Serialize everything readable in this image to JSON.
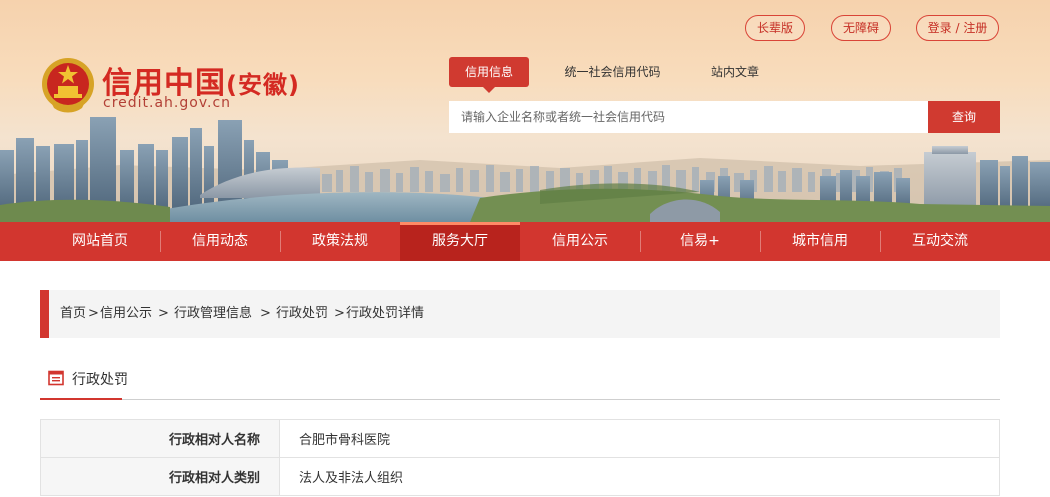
{
  "header": {
    "logo_title": "信用中国",
    "logo_region": "(安徽)",
    "logo_url": "credit.ah.gov.cn",
    "top_links": {
      "elder": "长辈版",
      "accessible": "无障碍",
      "login": "登录 / 注册"
    },
    "search_tabs": [
      "信用信息",
      "统一社会信用代码",
      "站内文章"
    ],
    "search": {
      "placeholder": "请输入企业名称或者统一社会信用代码",
      "button": "查询"
    }
  },
  "nav": {
    "items": [
      "网站首页",
      "信用动态",
      "政策法规",
      "服务大厅",
      "信用公示",
      "信易+",
      "城市信用",
      "互动交流"
    ],
    "active": "服务大厅"
  },
  "breadcrumb": [
    "首页",
    ">",
    "信用公示",
    ">",
    "行政管理信息",
    ">",
    "行政处罚",
    ">",
    "行政处罚详情"
  ],
  "section": {
    "title": "行政处罚"
  },
  "details": [
    {
      "label": "行政相对人名称",
      "value": "合肥市骨科医院"
    },
    {
      "label": "行政相对人类别",
      "value": "法人及非法人组织"
    }
  ],
  "colors": {
    "brand_red": "#d2362f",
    "nav_active": "#b8231d",
    "header_bg": "#f6d2ad"
  },
  "icons": [
    "national-emblem-icon",
    "document-list-icon"
  ]
}
